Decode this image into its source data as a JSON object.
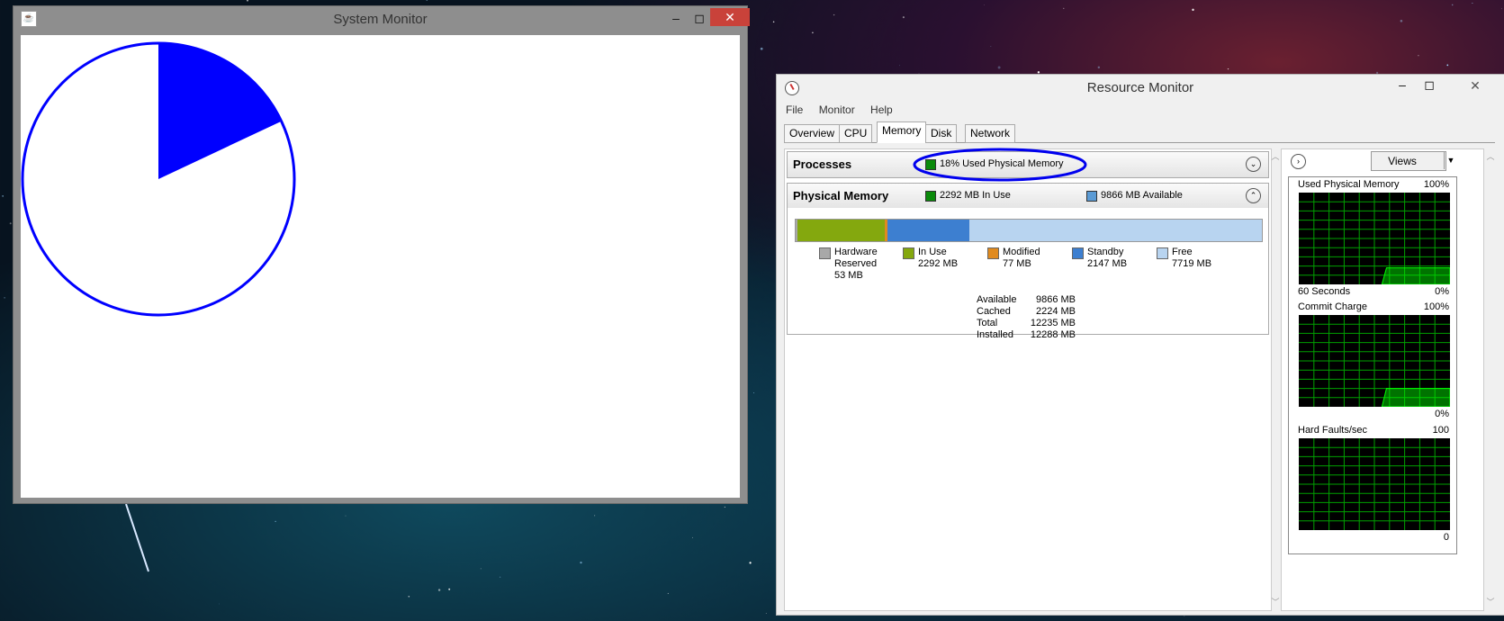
{
  "system_monitor": {
    "title": "System Monitor",
    "used_fraction": 0.18,
    "pie_fill_color": "#0000ff",
    "pie_outline_color": "#0000ff"
  },
  "resource_monitor": {
    "title": "Resource Monitor",
    "menu": [
      "File",
      "Monitor",
      "Help"
    ],
    "tabs": [
      "Overview",
      "CPU",
      "Memory",
      "Disk",
      "Network"
    ],
    "active_tab": "Memory",
    "processes": {
      "label": "Processes",
      "summary": "18% Used Physical Memory"
    },
    "physical_memory": {
      "label": "Physical Memory",
      "in_use_text": "2292 MB In Use",
      "available_text": "9866 MB Available",
      "bar": [
        {
          "name": "Hardware Reserved",
          "mb": 53,
          "color": "#a8a8a8"
        },
        {
          "name": "In Use",
          "mb": 2292,
          "color": "#84a80e"
        },
        {
          "name": "Modified",
          "mb": 77,
          "color": "#e08a1e"
        },
        {
          "name": "Standby",
          "mb": 2147,
          "color": "#3d7fd0"
        },
        {
          "name": "Free",
          "mb": 7719,
          "color": "#b8d4f0"
        }
      ],
      "legend": [
        {
          "line1": "Hardware",
          "line2": "Reserved",
          "line3": "53 MB"
        },
        {
          "line1": "In Use",
          "line2": "2292 MB",
          "line3": ""
        },
        {
          "line1": "Modified",
          "line2": "77 MB",
          "line3": ""
        },
        {
          "line1": "Standby",
          "line2": "2147 MB",
          "line3": ""
        },
        {
          "line1": "Free",
          "line2": "7719 MB",
          "line3": ""
        }
      ],
      "stats": [
        {
          "label": "Available",
          "value": "9866 MB"
        },
        {
          "label": "Cached",
          "value": "2224 MB"
        },
        {
          "label": "Total",
          "value": "12235 MB"
        },
        {
          "label": "Installed",
          "value": "12288 MB"
        }
      ]
    },
    "views_label": "Views",
    "graphs": [
      {
        "title": "Used Physical Memory",
        "max": "100%",
        "bottom_left": "60 Seconds",
        "bottom_right": "0%",
        "level": 0.18
      },
      {
        "title": "Commit Charge",
        "max": "100%",
        "bottom_left": "",
        "bottom_right": "0%",
        "level": 0.2
      },
      {
        "title": "Hard Faults/sec",
        "max": "100",
        "bottom_left": "",
        "bottom_right": "0",
        "level": 0
      }
    ],
    "graph_grid_color": "#00a000",
    "graph_fill_color": "#00ff00"
  }
}
